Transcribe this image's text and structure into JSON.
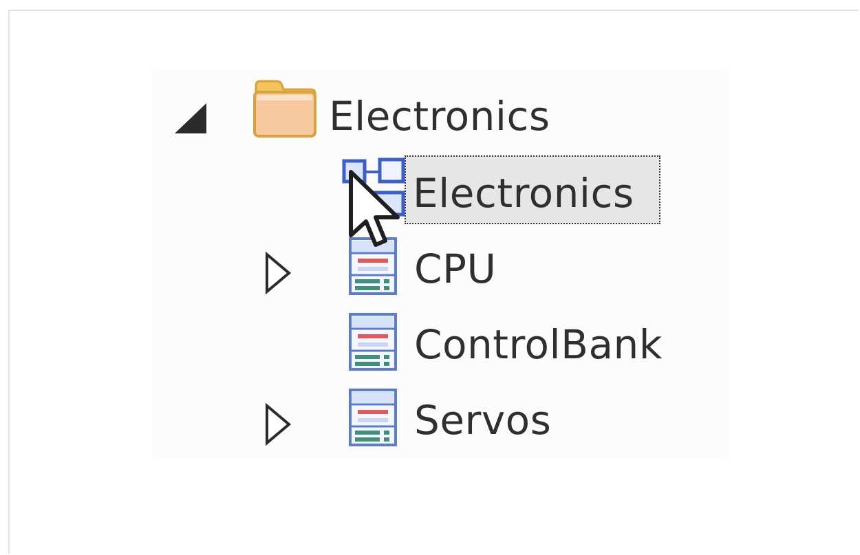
{
  "tree": {
    "root": {
      "label": "Electronics",
      "icon": "folder-icon",
      "expanded": true
    },
    "children": [
      {
        "label": "Electronics",
        "icon": "diagram-icon",
        "selected": true,
        "has_children": false
      },
      {
        "label": "CPU",
        "icon": "class-element-icon",
        "selected": false,
        "has_children": true,
        "expanded": false
      },
      {
        "label": "ControlBank",
        "icon": "class-element-icon",
        "selected": false,
        "has_children": false
      },
      {
        "label": "Servos",
        "icon": "class-element-icon",
        "selected": false,
        "has_children": true,
        "expanded": false
      }
    ]
  },
  "colors": {
    "folder_fill": "#f6c9a0",
    "folder_border": "#d9a23a",
    "selection_bg": "#e6e6e6",
    "element_blue": "#5a7bd6",
    "element_red": "#e05a5a",
    "element_green": "#3f8f7a"
  }
}
